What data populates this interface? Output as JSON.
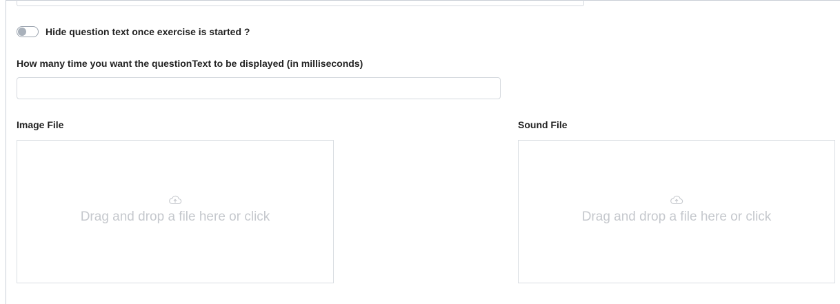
{
  "toggle": {
    "label": "Hide question text once exercise is started ?",
    "state": "off"
  },
  "display_time": {
    "label": "How many time you want the questionText to be displayed (in milliseconds)",
    "value": ""
  },
  "image_file": {
    "label": "Image File",
    "dropzone_text": "Drag and drop a file here or click",
    "icon": "cloud-upload-icon"
  },
  "sound_file": {
    "label": "Sound File",
    "dropzone_text": "Drag and drop a file here or click",
    "icon": "cloud-upload-icon"
  },
  "colors": {
    "border": "#d4d8de",
    "placeholder_text": "#c5c8cd",
    "label_text": "#222222"
  }
}
